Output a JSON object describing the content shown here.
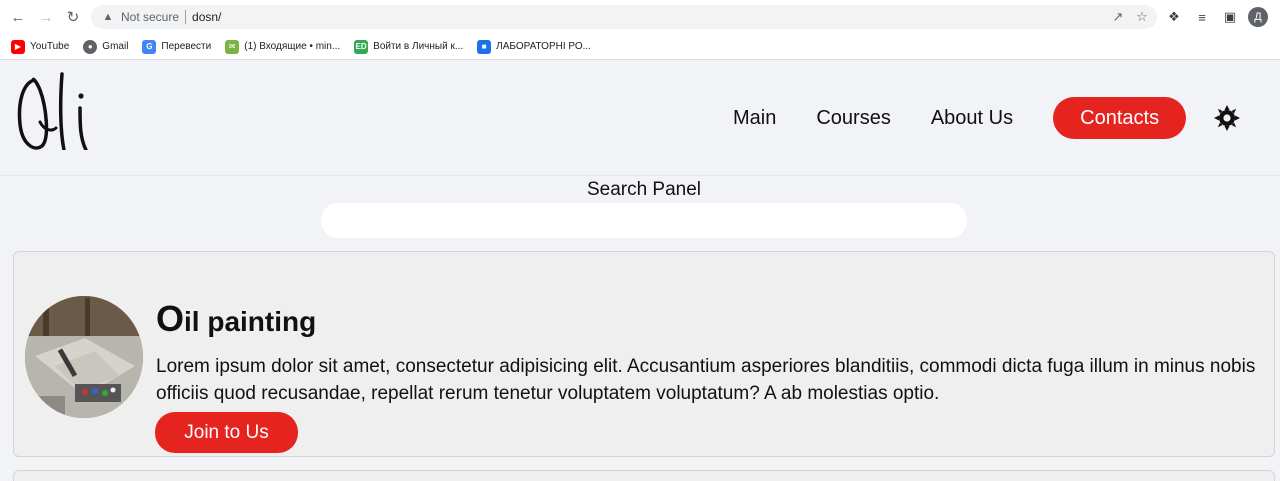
{
  "browser": {
    "security_label": "Not secure",
    "url": "dosn/",
    "profile_initial": "Д",
    "bookmarks": [
      {
        "label": "YouTube",
        "icon": "youtube-icon",
        "color": "#ff0000"
      },
      {
        "label": "Gmail",
        "icon": "globe-icon",
        "color": "#5f6368"
      },
      {
        "label": "Перевести",
        "icon": "translate-icon",
        "color": "#4285f4"
      },
      {
        "label": "(1) Входящие • min...",
        "icon": "mail-icon",
        "color": "#7cb342"
      },
      {
        "label": "Войти в Личный к...",
        "icon": "ed-icon",
        "color": "#34a853"
      },
      {
        "label": "ЛАБОРАТОРНІ РО...",
        "icon": "classroom-icon",
        "color": "#1a73e8"
      }
    ]
  },
  "header": {
    "logo_alt": "Oli",
    "nav": {
      "main": "Main",
      "courses": "Courses",
      "about": "About Us",
      "contacts": "Contacts"
    },
    "accent_color": "#e52420"
  },
  "search": {
    "label": "Search Panel",
    "value": "",
    "placeholder": ""
  },
  "card": {
    "title_initial": "O",
    "title_rest": "il painting",
    "text": "Lorem ipsum dolor sit amet, consectetur adipisicing elit. Accusantium asperiores blanditiis, commodi dicta fuga illum in minus nobis officiis quod recusandae, repellat rerum tenetur voluptatem voluptatum? A ab molestias optio.",
    "button": "Join to Us"
  }
}
